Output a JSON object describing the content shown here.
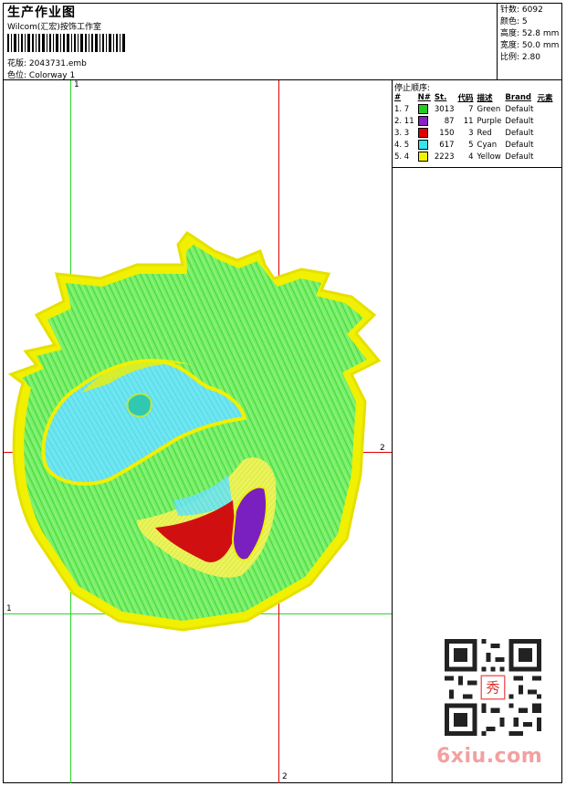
{
  "header": {
    "title": "生产作业图",
    "subtitle": "Wilcom(汇宏)按饰工作室",
    "design_label": "花版:",
    "design_value": "2043731.emb",
    "colorway_label": "色位:",
    "colorway_value": "Colorway 1"
  },
  "stats": [
    {
      "label": "针数:",
      "value": "6092"
    },
    {
      "label": "颜色:",
      "value": "5"
    },
    {
      "label": "高度:",
      "value": "52.8 mm"
    },
    {
      "label": "宽度:",
      "value": "50.0 mm"
    },
    {
      "label": "比例:",
      "value": "2.80"
    }
  ],
  "stop_sequence": {
    "title": "停止顺序:",
    "headers": [
      "#",
      "N#",
      "St.",
      "代码",
      "描述",
      "Brand",
      "元素"
    ],
    "rows": [
      {
        "idx": "1. 7",
        "color": "#22cc22",
        "st": "3013",
        "code": "7",
        "desc": "Green",
        "brand": "Default"
      },
      {
        "idx": "2. 11",
        "color": "#8a1fc4",
        "st": "87",
        "code": "11",
        "desc": "Purple",
        "brand": "Default"
      },
      {
        "idx": "3. 3",
        "color": "#e00000",
        "st": "150",
        "code": "3",
        "desc": "Red",
        "brand": "Default"
      },
      {
        "idx": "4. 5",
        "color": "#33e6ee",
        "st": "617",
        "code": "5",
        "desc": "Cyan",
        "brand": "Default"
      },
      {
        "idx": "5. 4",
        "color": "#f2f200",
        "st": "2223",
        "code": "4",
        "desc": "Yellow",
        "brand": "Default"
      }
    ]
  },
  "guides": {
    "green_top_label": "1",
    "green_left_label": "1",
    "red_right_label": "2",
    "red_bottom_label": "2"
  },
  "watermark": "6xiu.com",
  "qr_center_text": "秀"
}
